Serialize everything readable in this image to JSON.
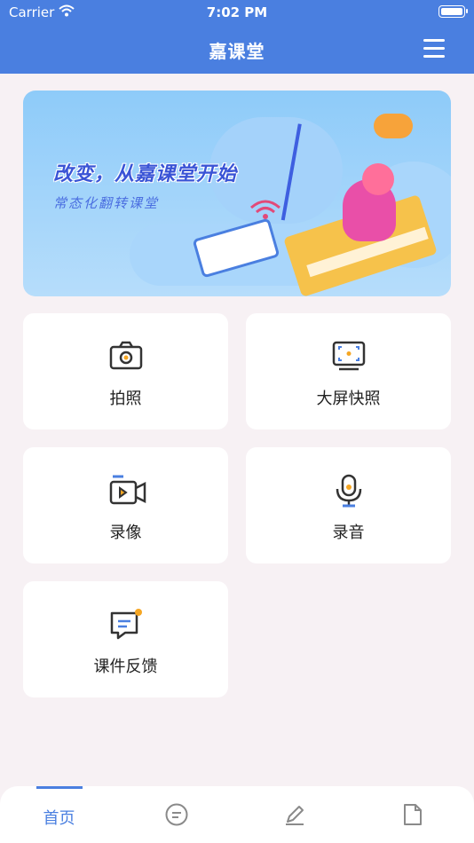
{
  "status_bar": {
    "carrier": "Carrier",
    "time": "7:02 PM"
  },
  "header": {
    "title": "嘉课堂",
    "menu_icon": "hamburger-menu-icon"
  },
  "banner": {
    "headline": "改变，从嘉课堂开始",
    "subline": "常态化翻转课堂"
  },
  "tiles": [
    {
      "label": "拍照",
      "icon": "camera-icon"
    },
    {
      "label": "大屏快照",
      "icon": "screen-capture-icon"
    },
    {
      "label": "录像",
      "icon": "video-camera-icon"
    },
    {
      "label": "录音",
      "icon": "microphone-icon"
    },
    {
      "label": "课件反馈",
      "icon": "feedback-message-icon"
    }
  ],
  "tabbar": [
    {
      "label": "首页",
      "active": true
    },
    {
      "icon": "chat-icon"
    },
    {
      "icon": "pencil-icon"
    },
    {
      "icon": "document-icon"
    }
  ],
  "colors": {
    "primary": "#4a7fe0",
    "accent": "#f5a623",
    "background": "#f7f1f4"
  }
}
